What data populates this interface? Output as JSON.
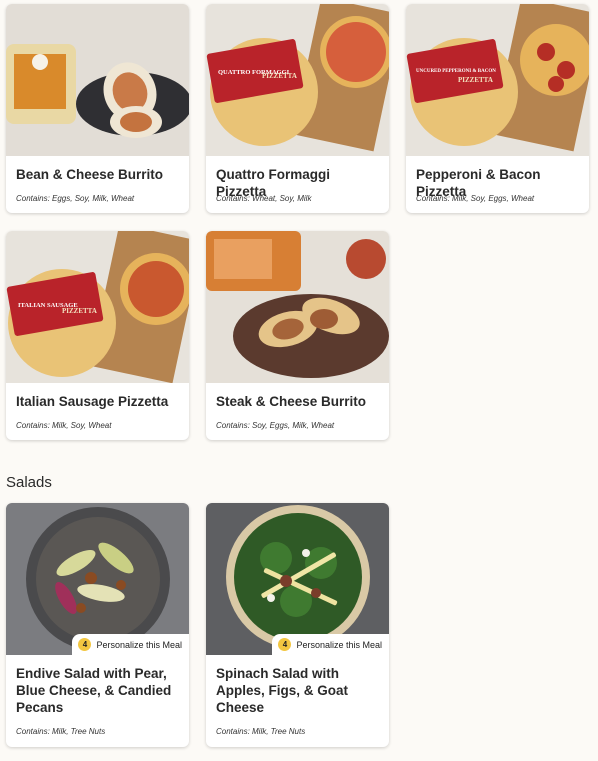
{
  "meals": [
    {
      "title": "Bean & Cheese Burrito",
      "contains": "Contains: Eggs, Soy, Milk, Wheat"
    },
    {
      "title": "Quattro Formaggi Pizzetta",
      "contains": "Contains: Wheat, Soy, Milk",
      "package_label": "QUATTRO FORMAGGI",
      "package_brand": "PIZZETTA"
    },
    {
      "title": "Pepperoni & Bacon Pizzetta",
      "contains": "Contains: Milk, Soy, Eggs, Wheat",
      "package_label": "UNCURED PEPPERONI & BACON",
      "package_brand": "PIZZETTA"
    },
    {
      "title": "Italian Sausage Pizzetta",
      "contains": "Contains: Milk, Soy, Wheat",
      "package_label": "ITALIAN SAUSAGE",
      "package_brand": "PIZZETTA"
    },
    {
      "title": "Steak & Cheese Burrito",
      "contains": "Contains: Soy, Eggs, Milk, Wheat"
    }
  ],
  "salads_section": {
    "title": "Salads",
    "items": [
      {
        "title": "Endive Salad with Pear, Blue Cheese, & Candied Pecans",
        "contains": "Contains: Milk, Tree Nuts",
        "badge_count": "4",
        "badge_label": "Personalize this Meal"
      },
      {
        "title": "Spinach Salad with Apples, Figs, & Goat Cheese",
        "contains": "Contains: Milk, Tree Nuts",
        "badge_count": "4",
        "badge_label": "Personalize this Meal"
      }
    ]
  }
}
